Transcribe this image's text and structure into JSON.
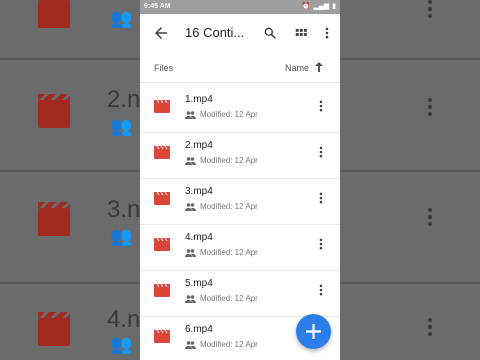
{
  "status_bar": {
    "time": "9:45 AM",
    "battery": "▮"
  },
  "app_bar": {
    "title": "16 Conti..."
  },
  "sort": {
    "section_label": "Files",
    "sort_label": "Name"
  },
  "files": [
    {
      "name": "1.mp4",
      "modified": "Modified: 12 Apr"
    },
    {
      "name": "2.mp4",
      "modified": "Modified: 12 Apr"
    },
    {
      "name": "3.mp4",
      "modified": "Modified: 12 Apr"
    },
    {
      "name": "4.mp4",
      "modified": "Modified: 12 Apr"
    },
    {
      "name": "5.mp4",
      "modified": "Modified: 12 Apr"
    },
    {
      "name": "6.mp4",
      "modified": "Modified: 12 Apr"
    }
  ],
  "background": {
    "visible_names": [
      "2.n",
      "3.n",
      "4.n"
    ]
  },
  "colors": {
    "accent": "#2b7de9",
    "video_icon": "#db4437"
  }
}
